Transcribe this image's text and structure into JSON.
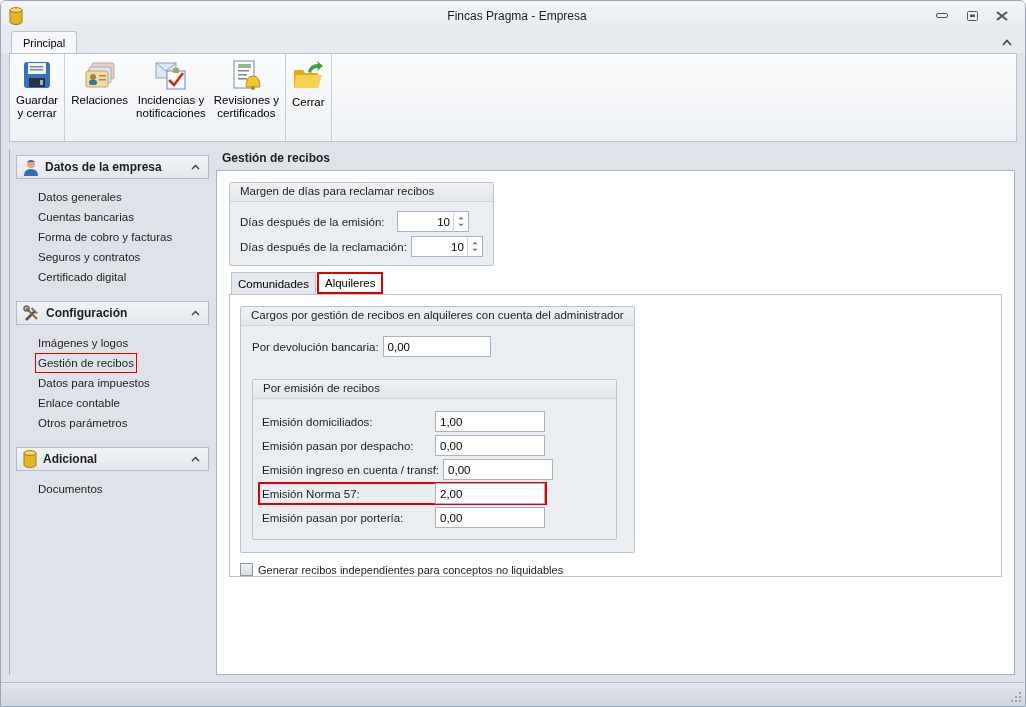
{
  "window": {
    "title": "Fincas Pragma - Empresa"
  },
  "ribbon": {
    "tabs": [
      {
        "label": "Principal",
        "selected": true
      }
    ],
    "groups": [
      {
        "buttons": [
          {
            "lines": [
              "Guardar",
              "y cerrar"
            ]
          }
        ]
      },
      {
        "buttons": [
          {
            "lines": [
              "Relaciones"
            ]
          },
          {
            "lines": [
              "Incidencias y",
              "notificaciones"
            ]
          },
          {
            "lines": [
              "Revisiones y",
              "certificados"
            ]
          }
        ]
      },
      {
        "buttons": [
          {
            "lines": [
              "Cerrar"
            ]
          }
        ]
      }
    ]
  },
  "sidebar": {
    "groups": [
      {
        "title": "Datos de la empresa",
        "expanded": true,
        "items": [
          {
            "label": "Datos generales",
            "highlighted": false
          },
          {
            "label": "Cuentas bancarias",
            "highlighted": false
          },
          {
            "label": "Forma de cobro y facturas",
            "highlighted": false
          },
          {
            "label": "Seguros y contratos",
            "highlighted": false
          },
          {
            "label": "Certificado digital",
            "highlighted": false
          }
        ]
      },
      {
        "title": "Configuración",
        "expanded": true,
        "items": [
          {
            "label": "Imágenes y logos",
            "highlighted": false
          },
          {
            "label": "Gestión de recibos",
            "highlighted": true
          },
          {
            "label": "Datos para impuestos",
            "highlighted": false
          },
          {
            "label": "Enlace contable",
            "highlighted": false
          },
          {
            "label": "Otros parámetros",
            "highlighted": false
          }
        ]
      },
      {
        "title": "Adicional",
        "expanded": true,
        "items": [
          {
            "label": "Documentos",
            "highlighted": false
          }
        ]
      }
    ]
  },
  "main": {
    "title": "Gestión de recibos",
    "margin_group": {
      "title": "Margen de días para reclamar recibos",
      "fields": [
        {
          "label": "Días después de la emisión:",
          "value": "10"
        },
        {
          "label": "Días después de la reclamación:",
          "value": "10"
        }
      ]
    },
    "tabs": [
      {
        "label": "Comunidades",
        "selected": false,
        "highlighted": false
      },
      {
        "label": "Alquileres",
        "selected": true,
        "highlighted": true
      }
    ],
    "charges_group": {
      "title": "Cargos por gestión de recibos en alquileres con cuenta del administrador",
      "fields": [
        {
          "label": "Por devolución bancaria:",
          "value": "0,00"
        }
      ],
      "subgroup": {
        "title": "Por emisión de recibos",
        "fields": [
          {
            "label": "Emisión domiciliados:",
            "value": "1,00",
            "highlighted": false
          },
          {
            "label": "Emisión pasan por despacho:",
            "value": "0,00",
            "highlighted": false
          },
          {
            "label": "Emisión ingreso en cuenta / transf:",
            "value": "0,00",
            "highlighted": false
          },
          {
            "label": "Emisión Norma 57:",
            "value": "2,00",
            "highlighted": true
          },
          {
            "label": "Emisión pasan por portería:",
            "value": "0,00",
            "highlighted": false
          }
        ]
      }
    },
    "checkbox": {
      "label": "Generar recibos independientes para conceptos no liquidables",
      "checked": false
    }
  }
}
